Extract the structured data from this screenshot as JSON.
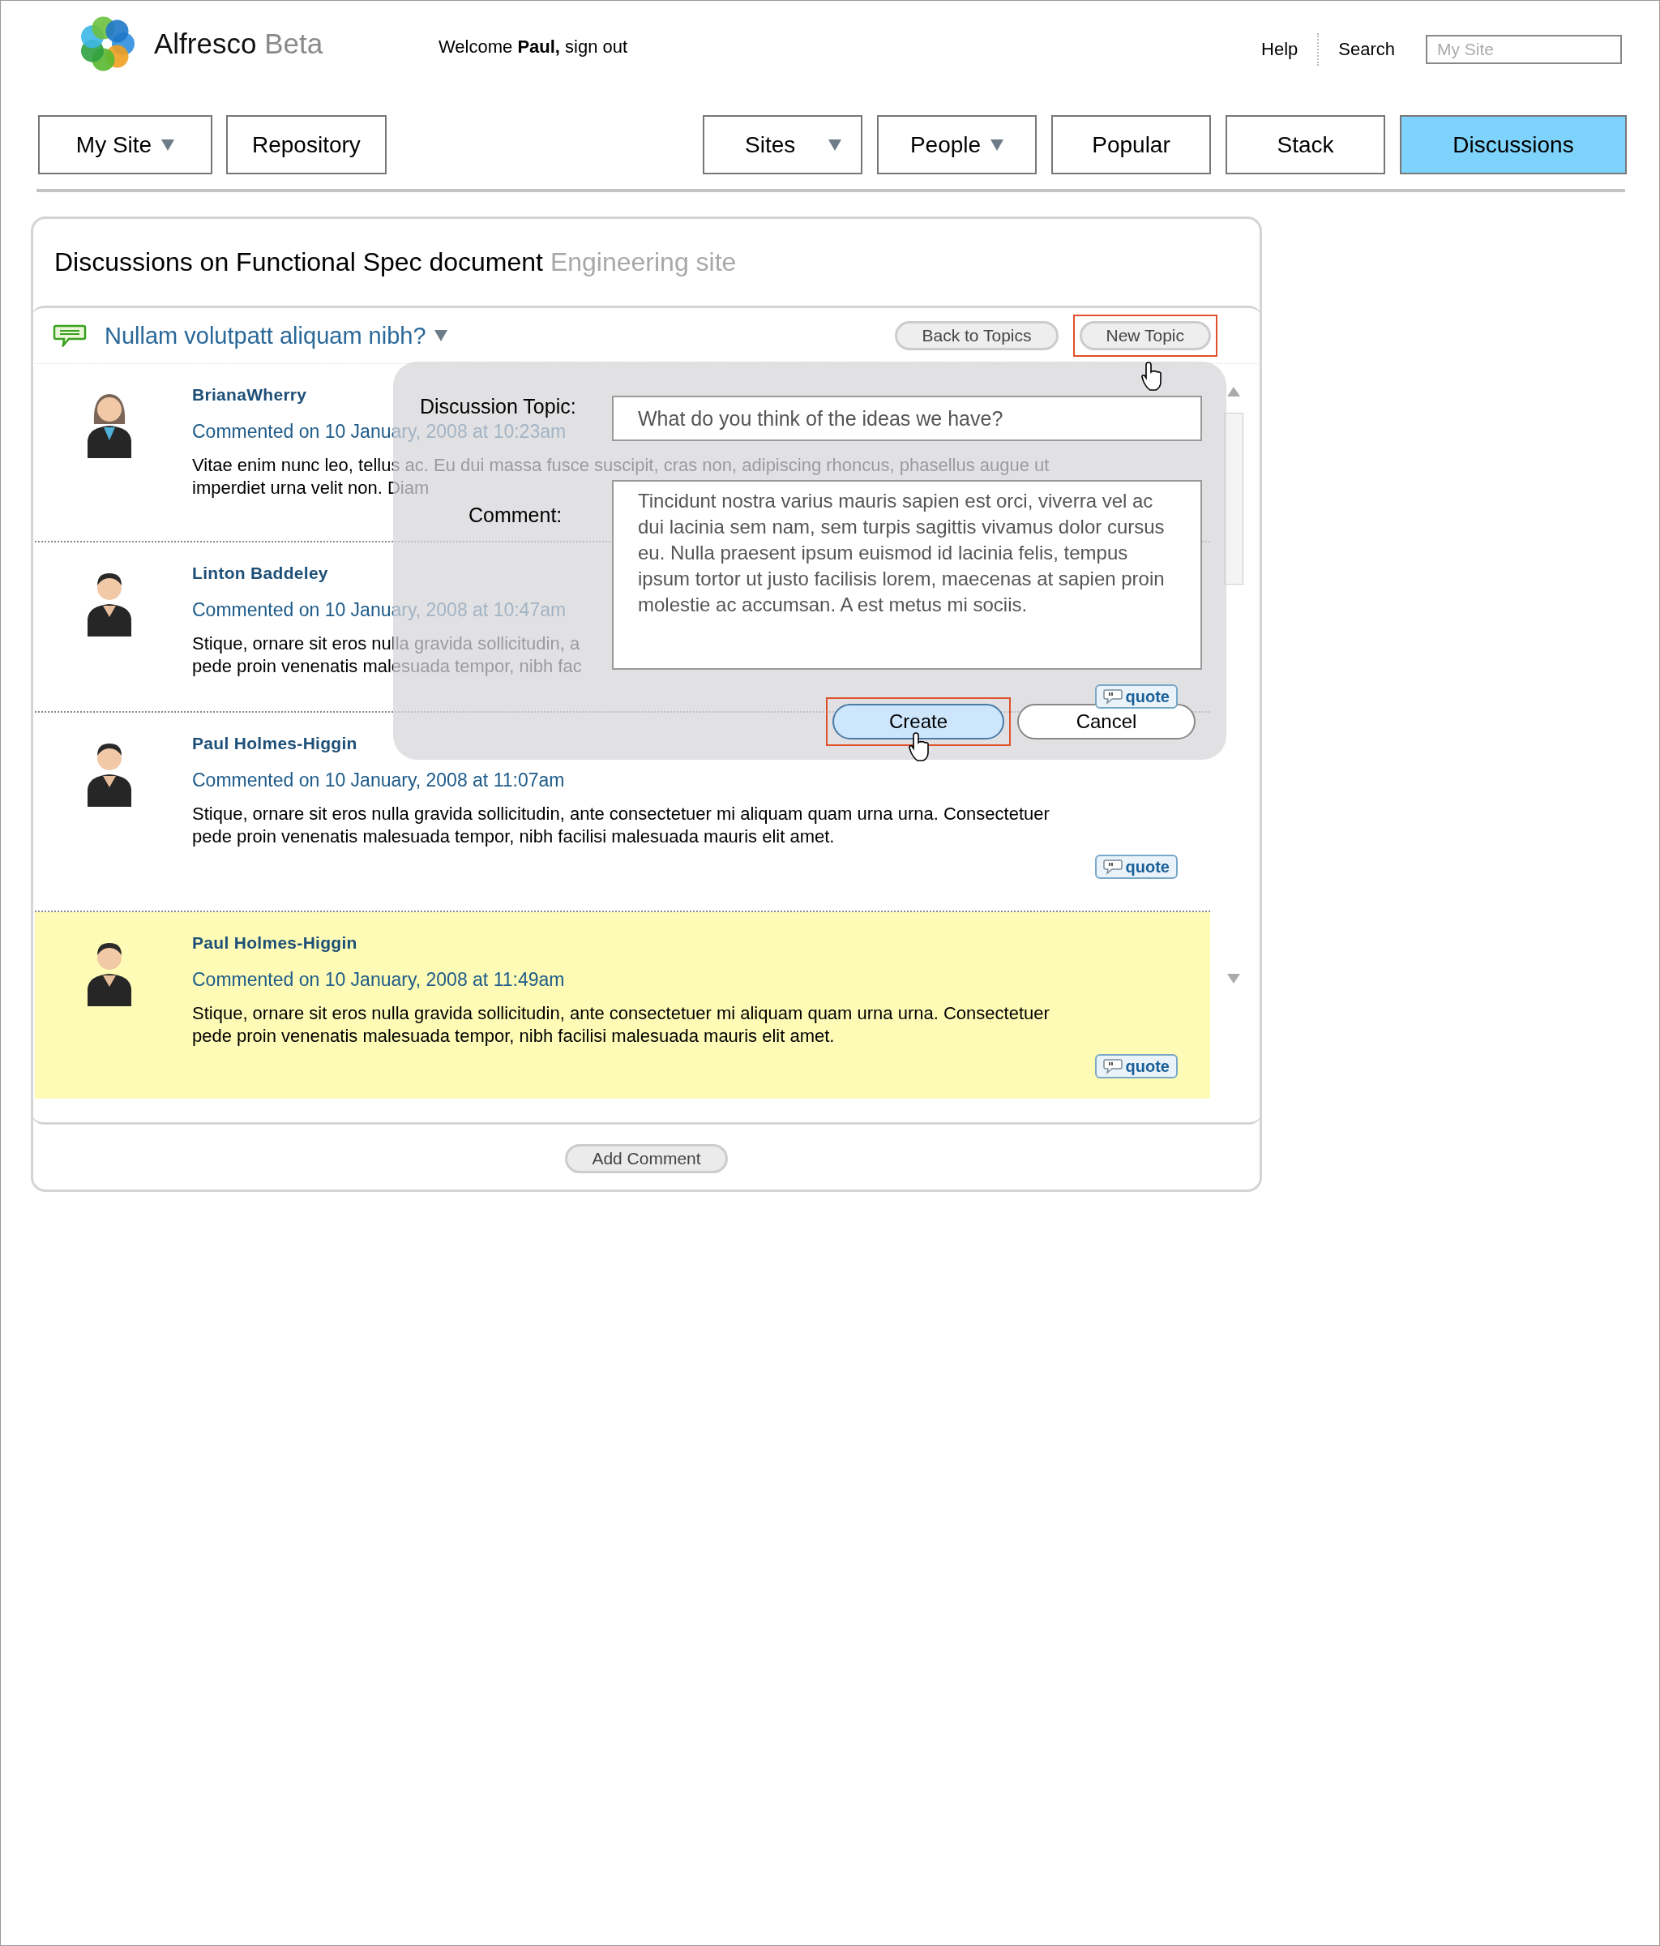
{
  "header": {
    "logo": "Alfresco",
    "logo_suffix": "Beta",
    "welcome": "Welcome **Paul,** sign out",
    "links": [
      "Help",
      "Search"
    ],
    "search": {
      "placeholder": "My Site"
    }
  },
  "nav": {
    "left": [
      {
        "label": "My Site",
        "dropdown": true,
        "selected": false
      },
      {
        "label": "Repository",
        "dropdown": false,
        "selected": false
      }
    ],
    "right": [
      {
        "label": "Sites",
        "dropdown": true,
        "selected": false
      },
      {
        "label": "People",
        "dropdown": true,
        "selected": false
      },
      {
        "label": "Popular",
        "dropdown": false,
        "selected": false
      },
      {
        "label": "Stack",
        "dropdown": false,
        "selected": false
      },
      {
        "label": "Discussions",
        "dropdown": false,
        "selected": true
      }
    ]
  },
  "panel": {
    "title": "Discussions on Functional Spec document",
    "subtitle": "Engineering site",
    "topic": {
      "title": "Nullam volutpatt aliquam nibh?",
      "dropdown": true
    },
    "buttons": [
      {
        "label": "Back to Topics",
        "highlighted": false
      },
      {
        "label": "New Topic",
        "highlighted": true
      }
    ],
    "comments": [
      {
        "kind": "female",
        "author": "BrianaWherry",
        "date": "Commented on 10 January, 2008 at 10:23am",
        "lines": [
          "Vitae enim nunc leo, tellus ac. Eu dui massa fusce suscipit, cras non, adipiscing rhoncus, phasellus augue ut",
          "imperdiet urna velit non. Diam"
        ],
        "highlighted": false
      },
      {
        "kind": "male",
        "author": "Linton Baddeley",
        "date": "Commented on 10 January, 2008 at 10:47am",
        "lines": [
          "Stique, ornare sit eros nulla gravida sollicitudin, a",
          "pede proin venenatis malesuada tempor, nibh fac"
        ],
        "quote": "quote",
        "highlighted": false
      },
      {
        "kind": "male",
        "author": "Paul Holmes-Higgin",
        "date": "Commented on 10 January, 2008 at 11:07am",
        "lines": [
          "Stique, ornare sit eros nulla gravida sollicitudin, ante consectetuer mi aliquam quam urna urna. Consectetuer",
          "pede proin venenatis malesuada tempor, nibh facilisi malesuada mauris elit amet."
        ],
        "quote": "quote",
        "highlighted": false
      },
      {
        "kind": "male",
        "author": "Paul Holmes-Higgin",
        "date": "Commented on 10 January, 2008 at 11:49am",
        "lines": [
          "Stique, ornare sit eros nulla gravida sollicitudin, ante consectetuer mi aliquam quam urna urna. Consectetuer",
          "pede proin venenatis malesuada tempor, nibh facilisi malesuada mauris elit amet."
        ],
        "quote": "quote",
        "highlighted": true
      }
    ],
    "add_comment": "Add Comment"
  },
  "dialog": {
    "fields": [
      {
        "kind": "input",
        "label": "Discussion Topic:",
        "value": "What do you think of the ideas we have?"
      },
      {
        "kind": "textarea",
        "label": "Comment:",
        "value": "Tincidunt nostra varius mauris sapien est orci, viverra vel ac dui lacinia sem nam, sem turpis sagittis vivamus dolor cursus eu. Nulla praesent ipsum euismod id lacinia felis, tempus ipsum tortor ut justo facilisis lorem, maecenas at sapien proin molestie ac accumsan. A est metus mi sociis."
      }
    ],
    "buttons": [
      {
        "kind": "primary",
        "label": "Create",
        "highlighted": true
      },
      {
        "kind": "secondary",
        "label": "Cancel",
        "highlighted": false
      }
    ]
  }
}
